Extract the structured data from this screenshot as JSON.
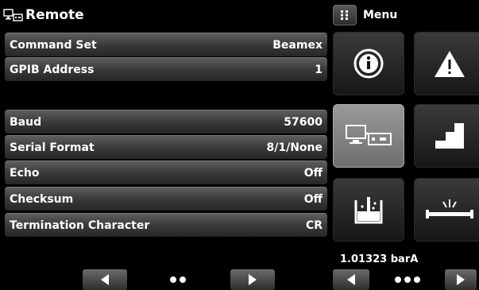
{
  "header": {
    "title": "Remote",
    "menu_label": "Menu"
  },
  "settings": [
    {
      "label": "Command Set",
      "value": "Beamex"
    },
    {
      "label": "GPIB Address",
      "value": "1"
    },
    {
      "label": "Baud",
      "value": "57600"
    },
    {
      "label": "Serial Format",
      "value": "8/1/None"
    },
    {
      "label": "Echo",
      "value": "Off"
    },
    {
      "label": "Checksum",
      "value": "Off"
    },
    {
      "label": "Termination Character",
      "value": "CR"
    }
  ],
  "tiles": [
    {
      "icon": "info-icon",
      "selected": false
    },
    {
      "icon": "warning-icon",
      "selected": false
    },
    {
      "icon": "remote-icon",
      "selected": true
    },
    {
      "icon": "step-icon",
      "selected": false
    },
    {
      "icon": "leak-test-icon",
      "selected": false
    },
    {
      "icon": "burst-icon",
      "selected": false
    }
  ],
  "status": {
    "pressure_reading": "1.01323 barA"
  },
  "pager": {
    "left_pages": 2,
    "right_pages": 3
  },
  "colors": {
    "background": "#000000",
    "selected_tile": "#8a8a8a",
    "warning": "#ffffff"
  }
}
